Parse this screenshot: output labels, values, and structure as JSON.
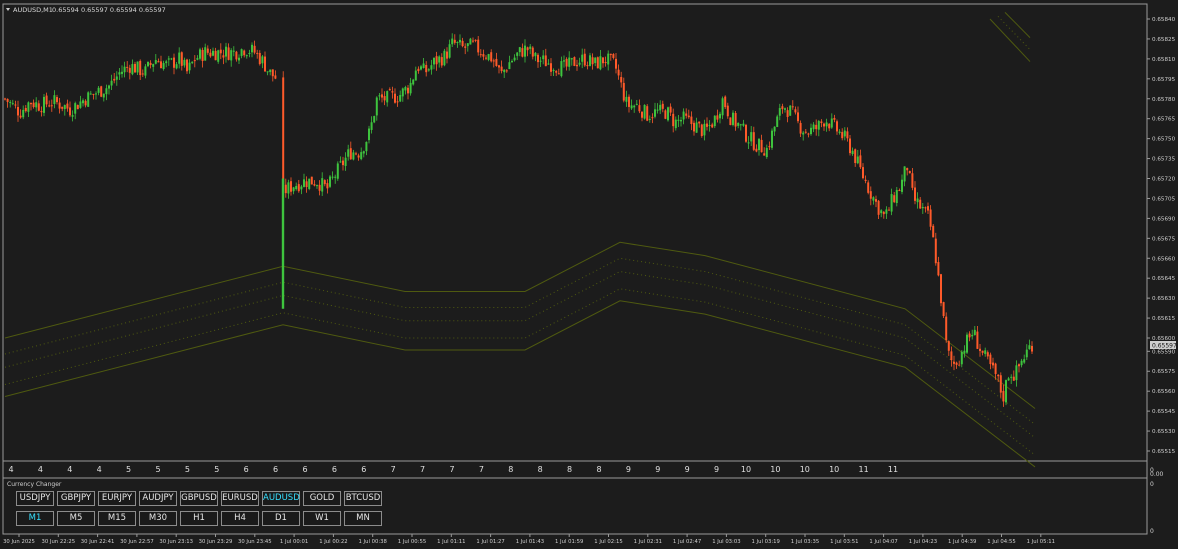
{
  "chart_header": {
    "symbol_tf": "AUDUSD,M1",
    "ohlc": "0.65594 0.65597 0.65594 0.65597"
  },
  "current_price": "0.65597",
  "colors": {
    "background": "#1c1c1c",
    "bull": "#3ec43e",
    "bear": "#ff5a2a",
    "channel": "#4f5a10",
    "active_text": "#36e0ff",
    "axis_text": "#d0d0d0"
  },
  "price_axis": [
    "0.65840",
    "0.65825",
    "0.65810",
    "0.65795",
    "0.65780",
    "0.65765",
    "0.65750",
    "0.65735",
    "0.65720",
    "0.65705",
    "0.65690",
    "0.65675",
    "0.65660",
    "0.65645",
    "0.65630",
    "0.65615",
    "0.65600",
    "0.65590",
    "0.65575",
    "0.65560",
    "0.65545",
    "0.65530",
    "0.65515"
  ],
  "day_axis": [
    "4",
    "4",
    "4",
    "4",
    "5",
    "5",
    "5",
    "5",
    "6",
    "6",
    "6",
    "6",
    "6",
    "7",
    "7",
    "7",
    "7",
    "8",
    "8",
    "8",
    "8",
    "9",
    "9",
    "9",
    "9",
    "10",
    "10",
    "10",
    "10",
    "11",
    "11"
  ],
  "time_axis": [
    "30 Jun 2025",
    "30 Jun 22:25",
    "30 Jun 22:41",
    "30 Jun 22:57",
    "30 Jun 23:13",
    "30 Jun 23:29",
    "30 Jun 23:45",
    "1 Jul 00:01",
    "1 Jul 00:22",
    "1 Jul 00:38",
    "1 Jul 00:55",
    "1 Jul 01:11",
    "1 Jul 01:27",
    "1 Jul 01:43",
    "1 Jul 01:59",
    "1 Jul 02:15",
    "1 Jul 02:31",
    "1 Jul 02:47",
    "1 Jul 03:03",
    "1 Jul 03:19",
    "1 Jul 03:35",
    "1 Jul 03:51",
    "1 Jul 04:07",
    "1 Jul 04:23",
    "1 Jul 04:39",
    "1 Jul 04:55",
    "1 Jul 05:11"
  ],
  "subwindow": {
    "title": "Currency Changer",
    "scale_top": "0",
    "scale_mid": "0",
    "scale_bottom": "0",
    "scale_main_bottom": "0.00"
  },
  "symbols": [
    {
      "label": "USDJPY",
      "active": false
    },
    {
      "label": "GBPJPY",
      "active": false
    },
    {
      "label": "EURJPY",
      "active": false
    },
    {
      "label": "AUDJPY",
      "active": false
    },
    {
      "label": "GBPUSD",
      "active": false
    },
    {
      "label": "EURUSD",
      "active": false
    },
    {
      "label": "AUDUSD",
      "active": true
    },
    {
      "label": "GOLD",
      "active": false
    },
    {
      "label": "BTCUSD",
      "active": false
    }
  ],
  "timeframes": [
    {
      "label": "M1",
      "active": true
    },
    {
      "label": "M5",
      "active": false
    },
    {
      "label": "M15",
      "active": false
    },
    {
      "label": "M30",
      "active": false
    },
    {
      "label": "H1",
      "active": false
    },
    {
      "label": "H4",
      "active": false
    },
    {
      "label": "D1",
      "active": false
    },
    {
      "label": "W1",
      "active": false
    },
    {
      "label": "MN",
      "active": false
    }
  ],
  "chart_data": {
    "type": "candlestick",
    "y_range": [
      0.6551,
      0.65845
    ],
    "path_points": [
      [
        0,
        0.6578
      ],
      [
        15,
        0.6577
      ],
      [
        25,
        0.65778
      ],
      [
        35,
        0.65775
      ],
      [
        48,
        0.65778
      ],
      [
        58,
        0.65775
      ],
      [
        65,
        0.65772
      ],
      [
        80,
        0.6578
      ],
      [
        92,
        0.65785
      ],
      [
        105,
        0.6579
      ],
      [
        115,
        0.658
      ],
      [
        125,
        0.65805
      ],
      [
        140,
        0.658
      ],
      [
        150,
        0.6581
      ],
      [
        162,
        0.65805
      ],
      [
        175,
        0.6581
      ],
      [
        182,
        0.658
      ],
      [
        190,
        0.6581
      ],
      [
        200,
        0.65815
      ],
      [
        215,
        0.65815
      ],
      [
        230,
        0.65815
      ],
      [
        240,
        0.65818
      ],
      [
        250,
        0.65815
      ],
      [
        258,
        0.65808
      ],
      [
        264,
        0.658
      ],
      [
        272,
        0.65795
      ],
      [
        278,
        0.6571
      ],
      [
        288,
        0.65715
      ],
      [
        300,
        0.65718
      ],
      [
        312,
        0.65718
      ],
      [
        322,
        0.65712
      ],
      [
        332,
        0.65725
      ],
      [
        345,
        0.6574
      ],
      [
        355,
        0.6574
      ],
      [
        365,
        0.65755
      ],
      [
        372,
        0.6578
      ],
      [
        382,
        0.6578
      ],
      [
        395,
        0.65783
      ],
      [
        405,
        0.6579
      ],
      [
        412,
        0.65805
      ],
      [
        420,
        0.658
      ],
      [
        430,
        0.65808
      ],
      [
        440,
        0.65812
      ],
      [
        448,
        0.65822
      ],
      [
        458,
        0.65818
      ],
      [
        468,
        0.6582
      ],
      [
        478,
        0.65815
      ],
      [
        488,
        0.6581
      ],
      [
        496,
        0.65798
      ],
      [
        505,
        0.65808
      ],
      [
        515,
        0.65815
      ],
      [
        522,
        0.65818
      ],
      [
        530,
        0.6581
      ],
      [
        540,
        0.65808
      ],
      [
        550,
        0.65805
      ],
      [
        560,
        0.65803
      ],
      [
        570,
        0.65808
      ],
      [
        580,
        0.6581
      ],
      [
        590,
        0.65806
      ],
      [
        600,
        0.6581
      ],
      [
        610,
        0.65805
      ],
      [
        616,
        0.6579
      ],
      [
        622,
        0.65775
      ],
      [
        632,
        0.65775
      ],
      [
        642,
        0.65768
      ],
      [
        652,
        0.6577
      ],
      [
        662,
        0.6577
      ],
      [
        670,
        0.65762
      ],
      [
        678,
        0.65765
      ],
      [
        690,
        0.6576
      ],
      [
        700,
        0.65755
      ],
      [
        710,
        0.65765
      ],
      [
        718,
        0.6578
      ],
      [
        726,
        0.65765
      ],
      [
        734,
        0.6576
      ],
      [
        742,
        0.65752
      ],
      [
        752,
        0.65745
      ],
      [
        762,
        0.65742
      ],
      [
        770,
        0.6576
      ],
      [
        778,
        0.65775
      ],
      [
        786,
        0.6577
      ],
      [
        794,
        0.6576
      ],
      [
        802,
        0.65755
      ],
      [
        812,
        0.65758
      ],
      [
        820,
        0.65765
      ],
      [
        830,
        0.65758
      ],
      [
        840,
        0.6575
      ],
      [
        848,
        0.6574
      ],
      [
        856,
        0.65725
      ],
      [
        864,
        0.65712
      ],
      [
        872,
        0.657
      ],
      [
        880,
        0.6569
      ],
      [
        888,
        0.65705
      ],
      [
        896,
        0.65715
      ],
      [
        902,
        0.6573
      ],
      [
        908,
        0.65705
      ],
      [
        916,
        0.65698
      ],
      [
        924,
        0.6569
      ],
      [
        930,
        0.65665
      ],
      [
        936,
        0.6563
      ],
      [
        942,
        0.6559
      ],
      [
        948,
        0.6558
      ],
      [
        954,
        0.65585
      ],
      [
        960,
        0.65595
      ],
      [
        968,
        0.65605
      ],
      [
        976,
        0.6559
      ],
      [
        984,
        0.6558
      ],
      [
        992,
        0.6557
      ],
      [
        998,
        0.65555
      ],
      [
        1004,
        0.65575
      ],
      [
        1010,
        0.65572
      ],
      [
        1016,
        0.65582
      ],
      [
        1022,
        0.6559
      ],
      [
        1028,
        0.65597
      ]
    ],
    "spike": {
      "x": 278,
      "from": 0.65622,
      "to": 0.6572
    },
    "channel_mid": [
      [
        0,
        0.65578
      ],
      [
        278,
        0.65632
      ],
      [
        400,
        0.65613
      ],
      [
        520,
        0.65613
      ],
      [
        615,
        0.6565
      ],
      [
        700,
        0.6564
      ],
      [
        900,
        0.656
      ],
      [
        1030,
        0.65525
      ]
    ],
    "channel_offsets": [
      0.0,
      -0.00022,
      -0.00013,
      0.0001,
      0.00022
    ]
  }
}
